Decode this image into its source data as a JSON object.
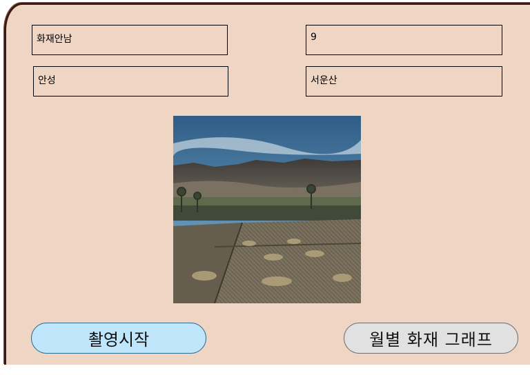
{
  "fields": {
    "top_left": "화재안남",
    "top_right": "9",
    "bottom_left": "안성",
    "bottom_right": "서운산"
  },
  "buttons": {
    "start_label": "촬영시작",
    "graph_label": "월별 화재 그래프"
  },
  "colors": {
    "panel_background": "#efd5c3",
    "start_button": "#bfe6fb",
    "graph_button": "#e1e1e1"
  }
}
